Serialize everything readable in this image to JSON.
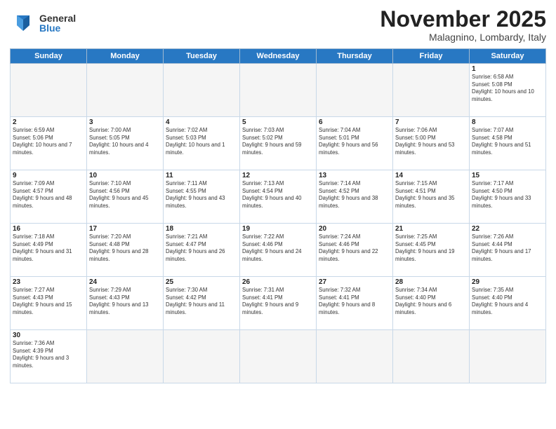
{
  "logo": {
    "general": "General",
    "blue": "Blue"
  },
  "title": "November 2025",
  "location": "Malagnino, Lombardy, Italy",
  "weekdays": [
    "Sunday",
    "Monday",
    "Tuesday",
    "Wednesday",
    "Thursday",
    "Friday",
    "Saturday"
  ],
  "weeks": [
    [
      {
        "day": "",
        "info": ""
      },
      {
        "day": "",
        "info": ""
      },
      {
        "day": "",
        "info": ""
      },
      {
        "day": "",
        "info": ""
      },
      {
        "day": "",
        "info": ""
      },
      {
        "day": "",
        "info": ""
      },
      {
        "day": "1",
        "info": "Sunrise: 6:58 AM\nSunset: 5:08 PM\nDaylight: 10 hours and 10 minutes."
      }
    ],
    [
      {
        "day": "2",
        "info": "Sunrise: 6:59 AM\nSunset: 5:06 PM\nDaylight: 10 hours and 7 minutes."
      },
      {
        "day": "3",
        "info": "Sunrise: 7:00 AM\nSunset: 5:05 PM\nDaylight: 10 hours and 4 minutes."
      },
      {
        "day": "4",
        "info": "Sunrise: 7:02 AM\nSunset: 5:03 PM\nDaylight: 10 hours and 1 minute."
      },
      {
        "day": "5",
        "info": "Sunrise: 7:03 AM\nSunset: 5:02 PM\nDaylight: 9 hours and 59 minutes."
      },
      {
        "day": "6",
        "info": "Sunrise: 7:04 AM\nSunset: 5:01 PM\nDaylight: 9 hours and 56 minutes."
      },
      {
        "day": "7",
        "info": "Sunrise: 7:06 AM\nSunset: 5:00 PM\nDaylight: 9 hours and 53 minutes."
      },
      {
        "day": "8",
        "info": "Sunrise: 7:07 AM\nSunset: 4:58 PM\nDaylight: 9 hours and 51 minutes."
      }
    ],
    [
      {
        "day": "9",
        "info": "Sunrise: 7:09 AM\nSunset: 4:57 PM\nDaylight: 9 hours and 48 minutes."
      },
      {
        "day": "10",
        "info": "Sunrise: 7:10 AM\nSunset: 4:56 PM\nDaylight: 9 hours and 45 minutes."
      },
      {
        "day": "11",
        "info": "Sunrise: 7:11 AM\nSunset: 4:55 PM\nDaylight: 9 hours and 43 minutes."
      },
      {
        "day": "12",
        "info": "Sunrise: 7:13 AM\nSunset: 4:54 PM\nDaylight: 9 hours and 40 minutes."
      },
      {
        "day": "13",
        "info": "Sunrise: 7:14 AM\nSunset: 4:52 PM\nDaylight: 9 hours and 38 minutes."
      },
      {
        "day": "14",
        "info": "Sunrise: 7:15 AM\nSunset: 4:51 PM\nDaylight: 9 hours and 35 minutes."
      },
      {
        "day": "15",
        "info": "Sunrise: 7:17 AM\nSunset: 4:50 PM\nDaylight: 9 hours and 33 minutes."
      }
    ],
    [
      {
        "day": "16",
        "info": "Sunrise: 7:18 AM\nSunset: 4:49 PM\nDaylight: 9 hours and 31 minutes."
      },
      {
        "day": "17",
        "info": "Sunrise: 7:20 AM\nSunset: 4:48 PM\nDaylight: 9 hours and 28 minutes."
      },
      {
        "day": "18",
        "info": "Sunrise: 7:21 AM\nSunset: 4:47 PM\nDaylight: 9 hours and 26 minutes."
      },
      {
        "day": "19",
        "info": "Sunrise: 7:22 AM\nSunset: 4:46 PM\nDaylight: 9 hours and 24 minutes."
      },
      {
        "day": "20",
        "info": "Sunrise: 7:24 AM\nSunset: 4:46 PM\nDaylight: 9 hours and 22 minutes."
      },
      {
        "day": "21",
        "info": "Sunrise: 7:25 AM\nSunset: 4:45 PM\nDaylight: 9 hours and 19 minutes."
      },
      {
        "day": "22",
        "info": "Sunrise: 7:26 AM\nSunset: 4:44 PM\nDaylight: 9 hours and 17 minutes."
      }
    ],
    [
      {
        "day": "23",
        "info": "Sunrise: 7:27 AM\nSunset: 4:43 PM\nDaylight: 9 hours and 15 minutes."
      },
      {
        "day": "24",
        "info": "Sunrise: 7:29 AM\nSunset: 4:43 PM\nDaylight: 9 hours and 13 minutes."
      },
      {
        "day": "25",
        "info": "Sunrise: 7:30 AM\nSunset: 4:42 PM\nDaylight: 9 hours and 11 minutes."
      },
      {
        "day": "26",
        "info": "Sunrise: 7:31 AM\nSunset: 4:41 PM\nDaylight: 9 hours and 9 minutes."
      },
      {
        "day": "27",
        "info": "Sunrise: 7:32 AM\nSunset: 4:41 PM\nDaylight: 9 hours and 8 minutes."
      },
      {
        "day": "28",
        "info": "Sunrise: 7:34 AM\nSunset: 4:40 PM\nDaylight: 9 hours and 6 minutes."
      },
      {
        "day": "29",
        "info": "Sunrise: 7:35 AM\nSunset: 4:40 PM\nDaylight: 9 hours and 4 minutes."
      }
    ],
    [
      {
        "day": "30",
        "info": "Sunrise: 7:36 AM\nSunset: 4:39 PM\nDaylight: 9 hours and 3 minutes."
      },
      {
        "day": "",
        "info": ""
      },
      {
        "day": "",
        "info": ""
      },
      {
        "day": "",
        "info": ""
      },
      {
        "day": "",
        "info": ""
      },
      {
        "day": "",
        "info": ""
      },
      {
        "day": "",
        "info": ""
      }
    ]
  ]
}
